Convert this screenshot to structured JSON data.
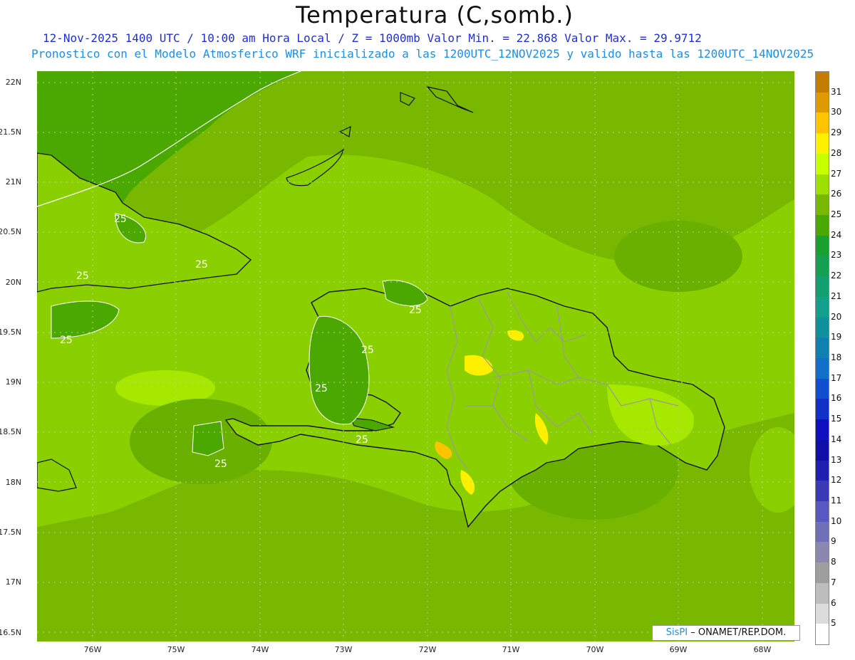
{
  "header": {
    "title": "Temperatura (C,somb.)",
    "subtitle_line1": "12-Nov-2025 1400 UTC / 10:00 am Hora Local / Z = 1000mb   Valor Min. = 22.868  Valor Max. = 29.9712",
    "subtitle_line2": "Pronostico con el Modelo Atmosferico WRF inicializado a las 1200UTC_12NOV2025 y valido hasta las  1200UTC_14NOV2025"
  },
  "map": {
    "lat_labels": [
      "22N",
      "21.5N",
      "21N",
      "20.5N",
      "20N",
      "19.5N",
      "19N",
      "18.5N",
      "18N",
      "17.5N",
      "17N",
      "16.5N"
    ],
    "lon_labels": [
      "76W",
      "75W",
      "74W",
      "73W",
      "72W",
      "71W",
      "70W",
      "69W",
      "68W"
    ],
    "contour_labels": [
      "25",
      "25",
      "25",
      "25",
      "25",
      "25",
      "25",
      "25",
      "25"
    ],
    "ocean_color": "#7ab800",
    "land_border_color": "#111111",
    "province_border_color": "#9a9a9a"
  },
  "credit": {
    "brand": "SisPI",
    "text": "ONAMET/REP.DOM."
  },
  "colorbar": {
    "labels": [
      "31",
      "30",
      "29",
      "28",
      "27",
      "26",
      "25",
      "24",
      "23",
      "22",
      "21",
      "20",
      "19",
      "18",
      "17",
      "16",
      "15",
      "14",
      "13",
      "12",
      "11",
      "10",
      "9",
      "8",
      "7",
      "6",
      "5"
    ],
    "colors": [
      "#c57d00",
      "#e09a00",
      "#ffc400",
      "#fff000",
      "#c8ff00",
      "#9de000",
      "#78b800",
      "#4aa800",
      "#18a030",
      "#14a050",
      "#13a070",
      "#12a08c",
      "#10909c",
      "#1080b0",
      "#1070c8",
      "#1050d0",
      "#1030c8",
      "#1010c0",
      "#1010a8",
      "#2020b0",
      "#3a3ab8",
      "#5858c0",
      "#7070b8",
      "#8a88b0",
      "#9e9e9e",
      "#bdbdbd",
      "#dcdcdc",
      "#ffffff"
    ]
  }
}
